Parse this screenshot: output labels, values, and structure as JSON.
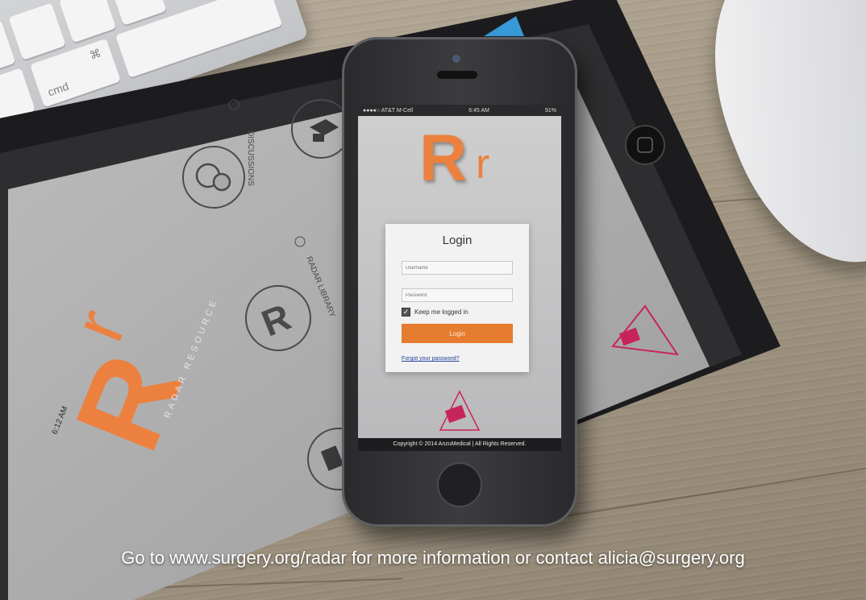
{
  "photo": {
    "keyboard_key_label": "cmd",
    "keyboard_key_symbol": "⌘",
    "caption": "Go to www.surgery.org/radar for more information or contact alicia@surgery.org"
  },
  "tablet": {
    "time": "6:12 AM",
    "logo_letter_large": "R",
    "logo_letter_small": "r",
    "brand_text": "RADAR RESOURCE",
    "menu": [
      {
        "label": "DISCUSSIONS",
        "icon": "chat-bubbles-icon"
      },
      {
        "label": "RADAR LIBRARY",
        "icon": "rr-logo-icon"
      },
      {
        "label": "",
        "icon": "graduation-cap-icon"
      },
      {
        "label": "",
        "icon": "document-icon"
      }
    ],
    "accent_color": "#ec813f"
  },
  "phone": {
    "status": {
      "carrier": "●●●●○ AT&T M-Cell",
      "time": "6:45 AM",
      "battery": "91%"
    },
    "logo_letter_large": "R",
    "logo_letter_small": "r",
    "login": {
      "title": "Login",
      "username_placeholder": "Username",
      "password_placeholder": "Password",
      "keep_logged_in": "Keep me logged in",
      "button_label": "Login",
      "forgot_password": "Forgot your password?"
    },
    "copyright": "Copyright © 2014 AnzuMedical | All Rights Reserved."
  },
  "colors": {
    "accent_orange": "#e67c2f",
    "link_blue": "#1f3f9c",
    "pink_logo": "#c8245c"
  }
}
